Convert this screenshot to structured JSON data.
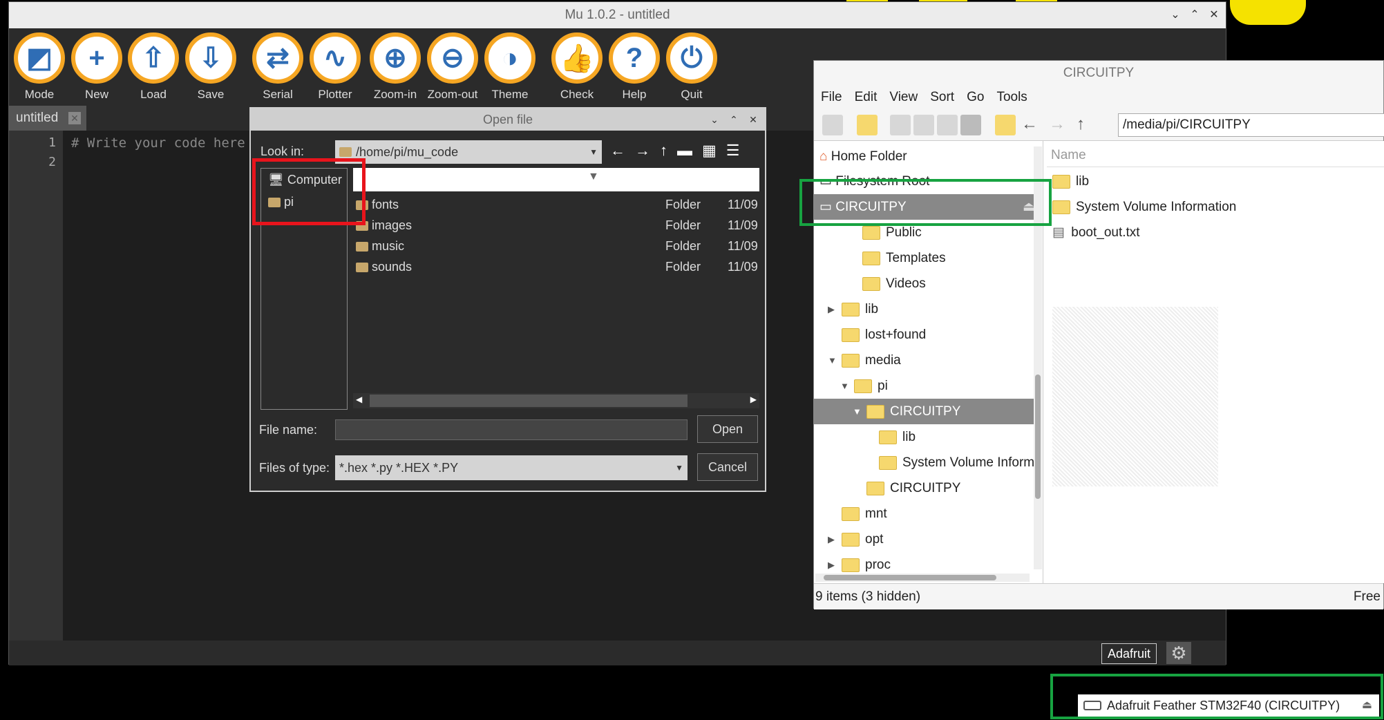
{
  "mu": {
    "title": "Mu 1.0.2 - untitled",
    "toolbar": [
      {
        "label": "Mode",
        "icon": "mode-icon",
        "glyph": "◩"
      },
      {
        "label": "New",
        "icon": "plus-icon",
        "glyph": "+"
      },
      {
        "label": "Load",
        "icon": "upload-icon",
        "glyph": "⇧"
      },
      {
        "label": "Save",
        "icon": "download-icon",
        "glyph": "⇩"
      },
      {
        "label": "Serial",
        "icon": "serial-icon",
        "glyph": "⇄"
      },
      {
        "label": "Plotter",
        "icon": "pulse-icon",
        "glyph": "∿"
      },
      {
        "label": "Zoom-in",
        "icon": "zoom-in-icon",
        "glyph": "⊕"
      },
      {
        "label": "Zoom-out",
        "icon": "zoom-out-icon",
        "glyph": "⊖"
      },
      {
        "label": "Theme",
        "icon": "theme-icon",
        "glyph": "◑"
      },
      {
        "label": "Check",
        "icon": "thumbs-up-icon",
        "glyph": "👍"
      },
      {
        "label": "Help",
        "icon": "help-icon",
        "glyph": "?"
      },
      {
        "label": "Quit",
        "icon": "power-icon",
        "glyph": "⏻"
      }
    ],
    "tab_label": "untitled",
    "line_numbers": [
      "1",
      "2"
    ],
    "code_line": "# Write your code here",
    "mode_badge": "Adafruit",
    "accent_color": "#f5a623"
  },
  "open_dialog": {
    "title": "Open file",
    "look_in_label": "Look in:",
    "look_in_value": "/home/pi/mu_code",
    "places": [
      "Computer",
      "pi"
    ],
    "files": [
      {
        "name": "fonts",
        "type": "Folder",
        "date": "11/09"
      },
      {
        "name": "images",
        "type": "Folder",
        "date": "11/09"
      },
      {
        "name": "music",
        "type": "Folder",
        "date": "11/09"
      },
      {
        "name": "sounds",
        "type": "Folder",
        "date": "11/09"
      }
    ],
    "file_name_label": "File name:",
    "file_name_value": "",
    "files_of_type_label": "Files of type:",
    "files_of_type_value": "*.hex *.py *.HEX *.PY",
    "open_button": "Open",
    "cancel_button": "Cancel"
  },
  "file_manager": {
    "title": "CIRCUITPY",
    "menu": [
      "File",
      "Edit",
      "View",
      "Sort",
      "Go",
      "Tools"
    ],
    "path": "/media/pi/CIRCUITPY",
    "places": [
      "Home Folder",
      "Filesystem Root",
      "CIRCUITPY"
    ],
    "tree": [
      "Public",
      "Templates",
      "Videos",
      "lib",
      "lost+found",
      "media",
      "pi",
      "CIRCUITPY",
      "lib",
      "System Volume Informa",
      "CIRCUITPY",
      "mnt",
      "opt",
      "proc"
    ],
    "column_header": "Name",
    "items": [
      "lib",
      "System Volume Information",
      "boot_out.txt"
    ],
    "status": "9 items (3 hidden)",
    "free_label": "Free"
  },
  "notification": {
    "text": "Adafruit Feather STM32F40 (CIRCUITPY)"
  },
  "colors": {
    "highlight_red": "#e8141c",
    "highlight_green": "#17a341"
  }
}
